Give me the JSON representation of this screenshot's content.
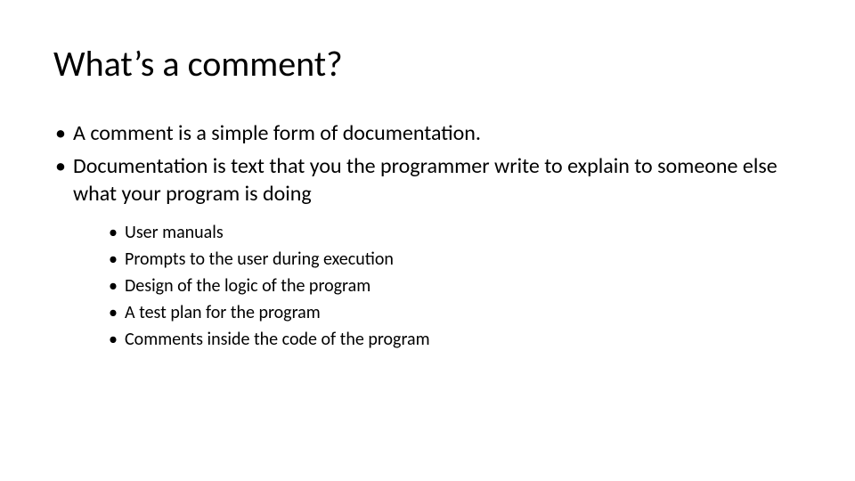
{
  "title": "What’s a comment?",
  "bullets": [
    "A comment is a simple form of documentation.",
    "Documentation is text that you the programmer write to explain to someone else what your program is doing"
  ],
  "subbullets": [
    "User manuals",
    "Prompts to the user during execution",
    "Design of the logic of the program",
    "A test plan for the program",
    "Comments inside the code of the program"
  ]
}
